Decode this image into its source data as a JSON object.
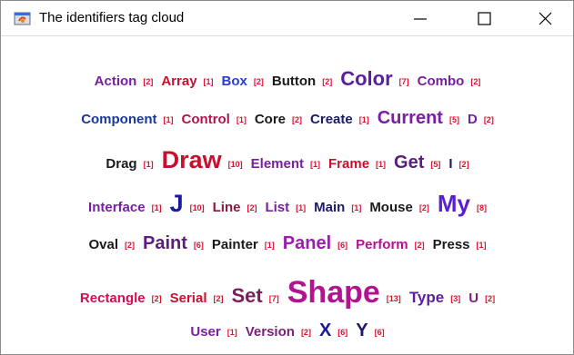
{
  "window": {
    "title": "The identifiers tag cloud",
    "icon": "java-coffee-icon",
    "buttons": {
      "minimize": "minimize-icon",
      "maximize": "maximize-icon",
      "close": "close-icon"
    }
  },
  "colors": {
    "small": "#c8102e",
    "mid": "#7a1fa2",
    "large": "#1a1a9a",
    "dark": "#1a1a1a"
  },
  "rows": [
    [
      {
        "word": "Action",
        "count": "[2]"
      },
      {
        "word": "Array",
        "count": "[1]"
      },
      {
        "word": "Box",
        "count": "[2]"
      },
      {
        "word": "Button",
        "count": "[2]"
      },
      {
        "word": "Color",
        "count": "[7]"
      },
      {
        "word": "Combo",
        "count": "[2]"
      }
    ],
    [
      {
        "word": "Component",
        "count": "[1]"
      },
      {
        "word": "Control",
        "count": "[1]"
      },
      {
        "word": "Core",
        "count": "[2]"
      },
      {
        "word": "Create",
        "count": "[1]"
      },
      {
        "word": "Current",
        "count": "[5]"
      },
      {
        "word": "D",
        "count": "[2]"
      }
    ],
    [
      {
        "word": "Drag",
        "count": "[1]"
      },
      {
        "word": "Draw",
        "count": "[10]"
      },
      {
        "word": "Element",
        "count": "[1]"
      },
      {
        "word": "Frame",
        "count": "[1]"
      },
      {
        "word": "Get",
        "count": "[5]"
      },
      {
        "word": "I",
        "count": "[2]"
      }
    ],
    [
      {
        "word": "Interface",
        "count": "[1]"
      },
      {
        "word": "J",
        "count": "[10]"
      },
      {
        "word": "Line",
        "count": "[2]"
      },
      {
        "word": "List",
        "count": "[1]"
      },
      {
        "word": "Main",
        "count": "[1]"
      },
      {
        "word": "Mouse",
        "count": "[2]"
      },
      {
        "word": "My",
        "count": "[8]"
      }
    ],
    [
      {
        "word": "Oval",
        "count": "[2]"
      },
      {
        "word": "Paint",
        "count": "[6]"
      },
      {
        "word": "Painter",
        "count": "[1]"
      },
      {
        "word": "Panel",
        "count": "[6]"
      },
      {
        "word": "Perform",
        "count": "[2]"
      },
      {
        "word": "Press",
        "count": "[1]"
      }
    ],
    [
      {
        "word": "Rectangle",
        "count": "[2]"
      },
      {
        "word": "Serial",
        "count": "[2]"
      },
      {
        "word": "Set",
        "count": "[7]"
      },
      {
        "word": "Shape",
        "count": "[13]"
      },
      {
        "word": "Type",
        "count": "[3]"
      },
      {
        "word": "U",
        "count": "[2]"
      }
    ],
    [
      {
        "word": "User",
        "count": "[1]"
      },
      {
        "word": "Version",
        "count": "[2]"
      },
      {
        "word": "X",
        "count": "[6]"
      },
      {
        "word": "Y",
        "count": "[6]"
      }
    ]
  ]
}
